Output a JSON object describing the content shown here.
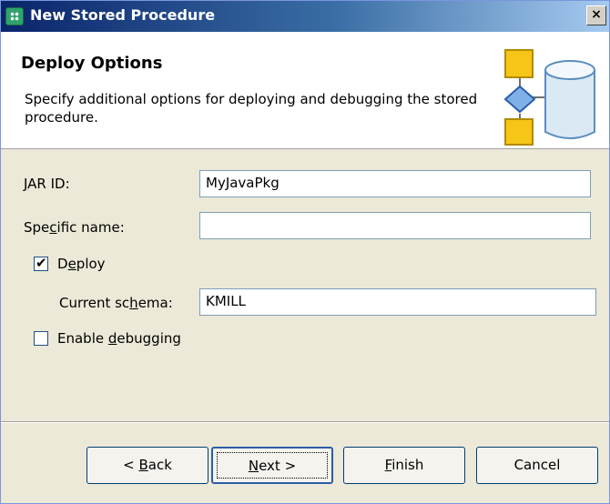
{
  "window": {
    "title": "New Stored Procedure",
    "close_glyph": "×",
    "icon": "wizard-icon"
  },
  "banner": {
    "title": "Deploy Options",
    "description": "Specify additional options for deploying and debugging the stored procedure.",
    "image": "database-procedure-icon"
  },
  "form": {
    "jar_id": {
      "label_pre": "",
      "label_ul": "J",
      "label_post": "AR ID:",
      "value": "MyJavaPkg"
    },
    "specific_name": {
      "label_pre": "Spe",
      "label_ul": "c",
      "label_post": "ific name:",
      "value": ""
    },
    "deploy": {
      "label_pre": "D",
      "label_ul": "e",
      "label_post": "ploy",
      "checked": true,
      "check_glyph": "✔"
    },
    "current_schema": {
      "label_pre": "Current sc",
      "label_ul": "h",
      "label_post": "ema:",
      "value": "KMILL"
    },
    "enable_debugging": {
      "label_pre": "Enable ",
      "label_ul": "d",
      "label_post": "ebugging",
      "checked": false
    }
  },
  "buttons": {
    "back": {
      "pre": "< ",
      "ul": "B",
      "post": "ack"
    },
    "next": {
      "pre": "",
      "ul": "N",
      "post": "ext >"
    },
    "finish": {
      "pre": "",
      "ul": "F",
      "post": "inish"
    },
    "cancel": {
      "pre": "",
      "ul": "",
      "post": "Cancel"
    }
  }
}
